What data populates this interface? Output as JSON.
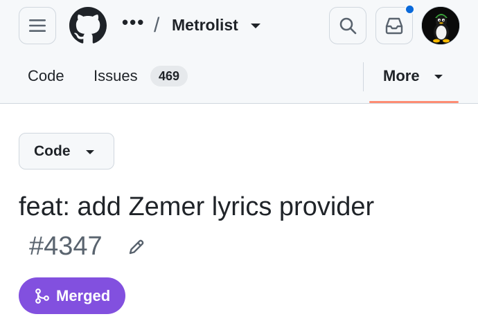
{
  "header": {
    "breadcrumb_more": "•••",
    "separator": "/",
    "repo_name": "Metrolist",
    "icons": {
      "menu": "hamburger-menu-icon",
      "logo": "github-mark-icon",
      "search": "search-icon",
      "inbox": "inbox-icon",
      "avatar": "tux-penguin-avatar"
    },
    "notification_dot_color": "#0969da"
  },
  "tabs": {
    "code_label": "Code",
    "issues_label": "Issues",
    "issues_count": "469",
    "more_label": "More",
    "active_underline_color": "#fd8c73"
  },
  "main": {
    "code_button_label": "Code",
    "pr_title": "feat: add Zemer lyrics provider",
    "pr_number": "#4347",
    "status_label": "Merged",
    "status_color": "#8250df"
  }
}
